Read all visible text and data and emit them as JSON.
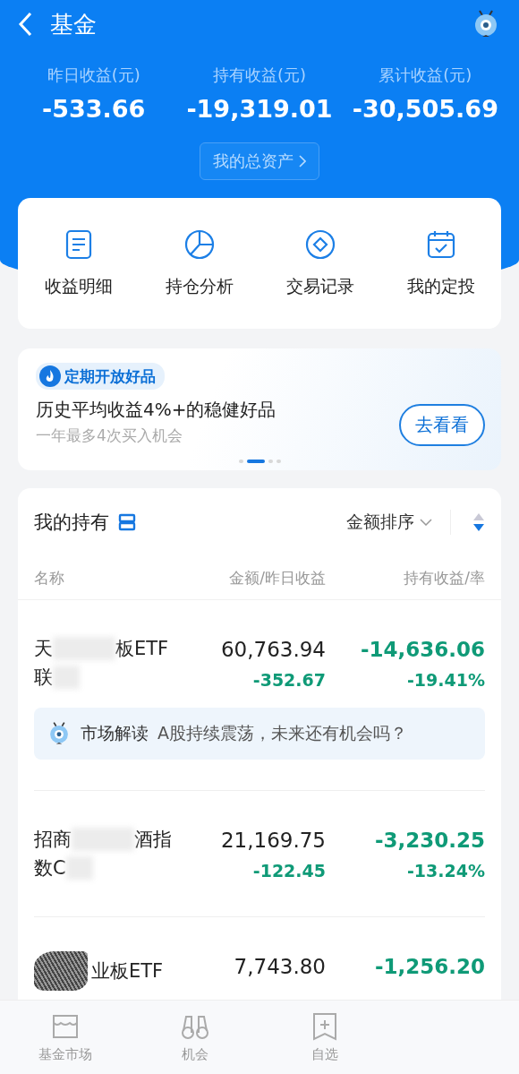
{
  "header": {
    "title": "基金"
  },
  "summary": [
    {
      "label": "昨日收益(元)",
      "value": "-533.66"
    },
    {
      "label": "持有收益(元)",
      "value": "-19,319.01"
    },
    {
      "label": "累计收益(元)",
      "value": "-30,505.69"
    }
  ],
  "assets_button": "我的总资产",
  "shortcuts": [
    {
      "kind": "doc",
      "label": "收益明细"
    },
    {
      "kind": "pie",
      "label": "持仓分析"
    },
    {
      "kind": "diamond",
      "label": "交易记录"
    },
    {
      "kind": "calendar",
      "label": "我的定投"
    }
  ],
  "banner": {
    "tag": "定期开放好品",
    "title": "历史平均收益4%+的稳健好品",
    "subtitle": "一年最多4次买入机会",
    "button": "去看看",
    "pages": [
      {
        "selected": false
      },
      {
        "selected": true
      },
      {
        "selected": false
      },
      {
        "selected": false
      }
    ]
  },
  "holdings": {
    "title": "我的持有",
    "sort": "金额排序",
    "columns": [
      "名称",
      "金额/昨日收益",
      "持有收益/率"
    ],
    "rows": [
      {
        "name_start": "天",
        "name_end": "板ETF",
        "name_line2": "联",
        "kind": "blurred",
        "amount": "60,763.94",
        "daily": "-352.67",
        "profit": "-14,636.06",
        "rate": "-19.41%",
        "note": {
          "label": "市场解读",
          "text": "A股持续震荡，未来还有机会吗？"
        }
      },
      {
        "name_start": "招商",
        "name_end": "酒指",
        "name_line2": "数C",
        "kind": "blurred",
        "amount": "21,169.75",
        "daily": "-122.45",
        "profit": "-3,230.25",
        "rate": "-13.24%"
      },
      {
        "name_start": "",
        "name_end": "业板ETF",
        "kind": "scribbled",
        "amount": "7,743.80",
        "profit": "-1,256.20"
      }
    ]
  },
  "tabbar": [
    {
      "kind": "store",
      "label": "基金市场"
    },
    {
      "kind": "binoculars",
      "label": "机会"
    },
    {
      "kind": "bookmark",
      "label": "自选"
    }
  ]
}
